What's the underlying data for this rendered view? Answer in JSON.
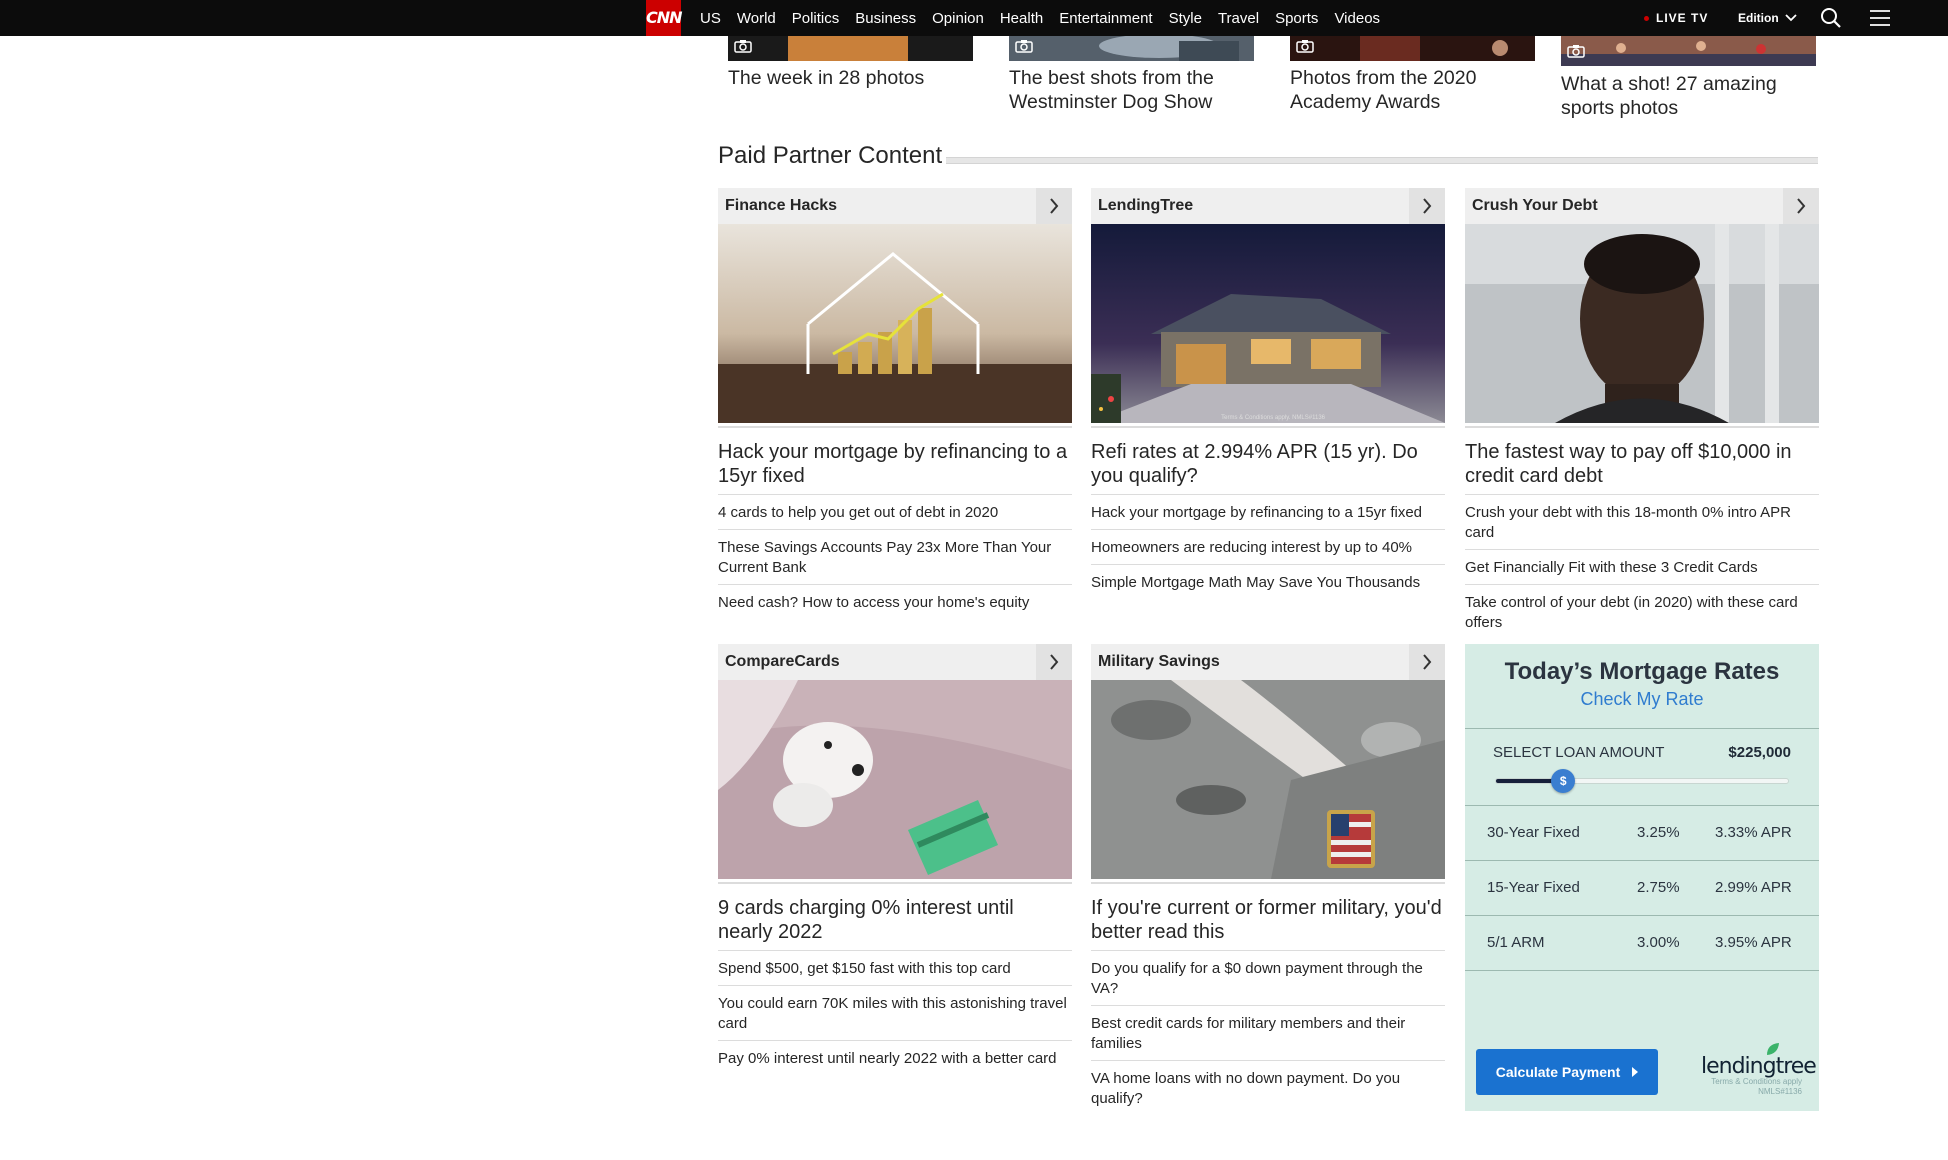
{
  "nav": {
    "logo": "CNN",
    "links": [
      "US",
      "World",
      "Politics",
      "Business",
      "Opinion",
      "Health",
      "Entertainment",
      "Style",
      "Travel",
      "Sports",
      "Videos"
    ],
    "live_tv": "LIVE TV",
    "edition": "Edition"
  },
  "gallery": [
    {
      "caption": "The week in 28 photos",
      "color": "#c9803a"
    },
    {
      "caption": "The best shots from the Westminster Dog Show",
      "color": "#55606b"
    },
    {
      "caption": "Photos from the 2020 Academy Awards",
      "color": "#6a2b20"
    },
    {
      "caption": "What a shot! 27 amazing sports photos",
      "color": "#8a5a4a"
    }
  ],
  "section": {
    "title": "Paid Partner Content"
  },
  "cards": [
    {
      "brand": "Finance Hacks",
      "title": "Hack your mortgage by refinancing to a 15yr fixed",
      "links": [
        "4 cards to help you get out of debt in 2020",
        "These Savings Accounts Pay 23x More Than Your Current Bank",
        "Need cash? How to access your home's equity"
      ]
    },
    {
      "brand": "LendingTree",
      "title": "Refi rates at 2.994% APR (15 yr). Do you qualify?",
      "image_fine_print": "Terms & Conditions apply. NMLS#1136",
      "links": [
        "Hack your mortgage by refinancing to a 15yr fixed",
        "Homeowners are reducing interest by up to 40%",
        "Simple Mortgage Math May Save You Thousands"
      ]
    },
    {
      "brand": "Crush Your Debt",
      "title": "The fastest way to pay off $10,000 in credit card debt",
      "links": [
        "Crush your debt with this 18-month 0% intro APR card",
        "Get Financially Fit with these 3 Credit Cards",
        "Take control of your debt (in 2020) with these card offers"
      ]
    },
    {
      "brand": "CompareCards",
      "title": "9 cards charging 0% interest until nearly 2022",
      "links": [
        "Spend $500, get $150 fast with this top card",
        "You could earn 70K miles with this astonishing travel card",
        "Pay 0% interest until nearly 2022 with a better card"
      ]
    },
    {
      "brand": "Military Savings",
      "title": "If you're current or former military, you'd better read this",
      "links": [
        "Do you qualify for a $0 down payment through the VA?",
        "Best credit cards for military members and their families",
        "VA home loans with no down payment. Do you qualify?"
      ]
    }
  ],
  "widget": {
    "title": "Today’s Mortgage Rates",
    "link": "Check My Rate",
    "loan_label": "SELECT LOAN AMOUNT",
    "loan_value": "$225,000",
    "slider_fraction": 0.23,
    "knob_symbol": "$",
    "rates": [
      {
        "name": "30-Year Fixed",
        "rate": "3.25%",
        "apr": "3.33% APR"
      },
      {
        "name": "15-Year Fixed",
        "rate": "2.75%",
        "apr": "2.99% APR"
      },
      {
        "name": "5/1 ARM",
        "rate": "3.00%",
        "apr": "3.95% APR"
      }
    ],
    "button": "Calculate Payment",
    "logo": "lendingtree",
    "fine_print_1": "Terms & Conditions apply",
    "fine_print_2": "NMLS#1136",
    "bg_color": "#d6ece5",
    "accent_color": "#1a72d0"
  }
}
